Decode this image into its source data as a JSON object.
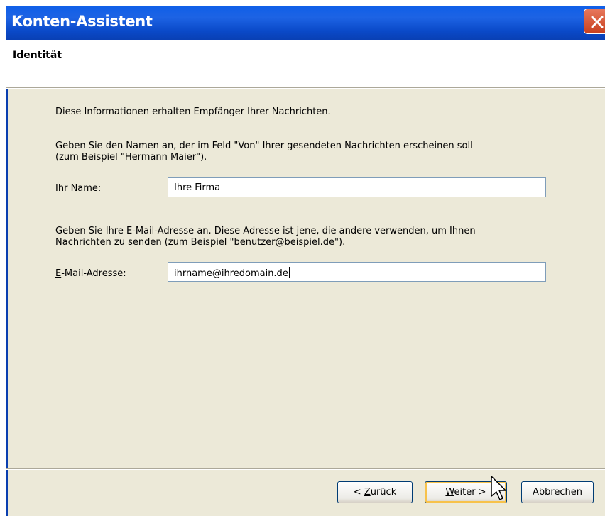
{
  "window": {
    "title": "Konten-Assistent"
  },
  "header": {
    "title": "Identität"
  },
  "content": {
    "intro": "Diese Informationen erhalten Empfänger Ihrer Nachrichten.",
    "name_desc_line1": "Geben Sie den Namen an, der im Feld \"Von\" Ihrer gesendeten Nachrichten erscheinen soll",
    "name_desc_line2": "(zum Beispiel \"Hermann Maier\").",
    "name_label_pre": "Ihr ",
    "name_label_key": "N",
    "name_label_post": "ame:",
    "name_value": "Ihre Firma",
    "email_desc_line1": "Geben Sie Ihre E-Mail-Adresse an. Diese Adresse ist jene, die andere verwenden, um Ihnen",
    "email_desc_line2": "Nachrichten zu senden (zum Beispiel \"benutzer@beispiel.de\").",
    "email_label_key": "E",
    "email_label_post": "-Mail-Adresse:",
    "email_value": "ihrname@ihredomain.de"
  },
  "buttons": {
    "back_pre": "< ",
    "back_key": "Z",
    "back_post": "urück",
    "next_key": "W",
    "next_post": "eiter >",
    "cancel": "Abbrechen"
  },
  "colors": {
    "titlebar": "#0a49c8",
    "dialog_bg": "#ece9d8",
    "default_button_highlight": "#f7c24b"
  },
  "icons": [
    "close-icon",
    "mouse-cursor-icon"
  ]
}
